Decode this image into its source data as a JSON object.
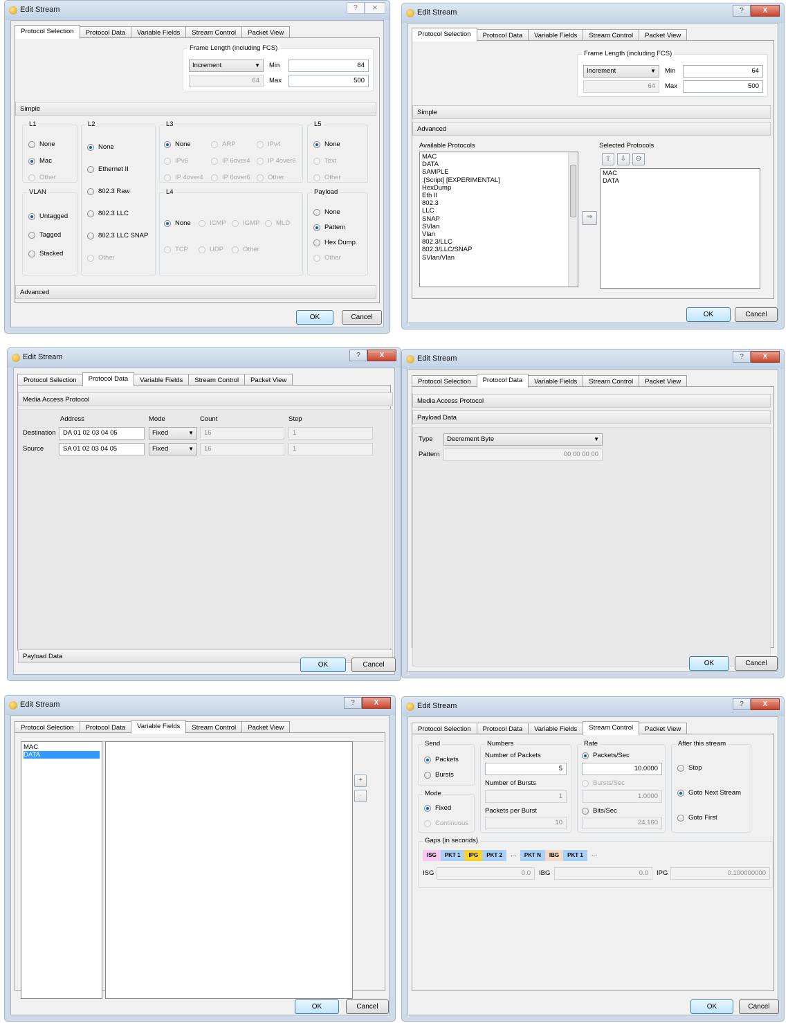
{
  "common": {
    "title": "Edit Stream",
    "ok": "OK",
    "cancel": "Cancel",
    "help": "?",
    "close": "X",
    "close_flat": "⨯",
    "tabs": [
      "Protocol Selection",
      "Protocol Data",
      "Variable Fields",
      "Stream Control",
      "Packet View"
    ]
  },
  "d1": {
    "frame_title": "Frame Length (including FCS)",
    "mode": "Increment",
    "min_label": "Min",
    "min_value": "64",
    "max_label": "Max",
    "max_value": "500",
    "disabled_value": "64",
    "simple": "Simple",
    "advanced": "Advanced",
    "l1": {
      "title": "L1",
      "opts": [
        "None",
        "Mac",
        "Other"
      ]
    },
    "vlan": {
      "title": "VLAN",
      "opts": [
        "Untagged",
        "Tagged",
        "Stacked"
      ]
    },
    "l2": {
      "title": "L2",
      "opts": [
        "None",
        "Ethernet II",
        "802.3 Raw",
        "802.3 LLC",
        "802.3 LLC SNAP",
        "Other"
      ]
    },
    "l3": {
      "title": "L3",
      "opts": [
        "None",
        "ARP",
        "IPv4",
        "IPv6",
        "IP 6over4",
        "IP 4over6",
        "IP 4over4",
        "IP 6over6",
        "Other"
      ]
    },
    "l4": {
      "title": "L4",
      "opts": [
        "None",
        "ICMP",
        "IGMP",
        "MLD",
        "TCP",
        "UDP",
        "Other"
      ]
    },
    "l5": {
      "title": "L5",
      "opts": [
        "None",
        "Text",
        "Other"
      ]
    },
    "payload": {
      "title": "Payload",
      "opts": [
        "None",
        "Pattern",
        "Hex Dump",
        "Other"
      ]
    }
  },
  "d2": {
    "frame_title": "Frame Length (including FCS)",
    "mode": "Increment",
    "min_label": "Min",
    "min_value": "64",
    "max_label": "Max",
    "max_value": "500",
    "disabled_value": "64",
    "simple": "Simple",
    "advanced": "Advanced",
    "available_title": "Available Protocols",
    "selected_title": "Selected Protocols",
    "available": [
      "MAC",
      "DATA",
      "SAMPLE",
      ":[Script] [EXPERIMENTAL]",
      "HexDump",
      "Eth II",
      "802.3",
      "LLC",
      "SNAP",
      "SVlan",
      "Vlan",
      "802.3/LLC",
      "802.3/LLC/SNAP",
      "SVlan/Vlan"
    ],
    "selected": [
      "MAC",
      "DATA"
    ],
    "up": "⇧",
    "down": "⇩",
    "remove": "⊖",
    "add": "⇒"
  },
  "d3": {
    "mac_header": "Media Access Protocol",
    "payload_header": "Payload Data",
    "cols": [
      "Address",
      "Mode",
      "Count",
      "Step"
    ],
    "rows": [
      {
        "label": "Destination",
        "address": "DA 01 02 03 04 05",
        "mode": "Fixed",
        "count": "16",
        "step": "1"
      },
      {
        "label": "Source",
        "address": "SA 01 02 03 04 05",
        "mode": "Fixed",
        "count": "16",
        "step": "1"
      }
    ]
  },
  "d4": {
    "mac_header": "Media Access Protocol",
    "payload_header": "Payload Data",
    "type_label": "Type",
    "type_value": "Decrement Byte",
    "pattern_label": "Pattern",
    "pattern_value": "00 00 00 00"
  },
  "d5": {
    "items": [
      "MAC",
      "DATA"
    ],
    "plus": "+",
    "minus": "-"
  },
  "d6": {
    "send_title": "Send",
    "send_opts": [
      "Packets",
      "Bursts"
    ],
    "mode_title": "Mode",
    "mode_opts": [
      "Fixed",
      "Continuous"
    ],
    "numbers_title": "Numbers",
    "num_packets_label": "Number of Packets",
    "num_packets": "5",
    "num_bursts_label": "Number of Bursts",
    "num_bursts": "1",
    "ppb_label": "Packets per Burst",
    "ppb": "10",
    "rate_title": "Rate",
    "pps_label": "Packets/Sec",
    "pps": "10.0000",
    "bps_label": "Bursts/Sec",
    "bps": "1.0000",
    "bitps_label": "Bits/Sec",
    "bitps": "24,160",
    "after_title": "After this stream",
    "after_opts": [
      "Stop",
      "Goto Next Stream",
      "Goto First"
    ],
    "gaps_title": "Gaps (in seconds)",
    "chips": [
      "ISG",
      "PKT 1",
      "IPG",
      "PKT 2",
      "···",
      "PKT N",
      "IBG",
      "PKT 1",
      "···"
    ],
    "isg_label": "ISG",
    "isg": "0.0",
    "ibg_label": "IBG",
    "ibg": "0.0",
    "ipg_label": "IPG",
    "ipg": "0.100000000"
  }
}
